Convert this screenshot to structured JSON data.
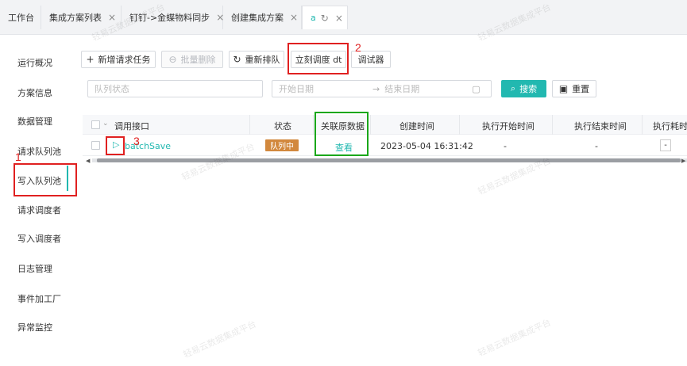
{
  "tabs": [
    {
      "label": "工作台",
      "closable": false
    },
    {
      "label": "集成方案列表",
      "closable": true
    },
    {
      "label": "钉钉->金蝶物料同步",
      "closable": true
    },
    {
      "label": "创建集成方案",
      "closable": true
    },
    {
      "label": "a",
      "closable": true,
      "active": true
    }
  ],
  "sidebar": {
    "items": [
      {
        "label": "运行概况"
      },
      {
        "label": "方案信息"
      },
      {
        "label": "数据管理"
      },
      {
        "label": "请求队列池"
      },
      {
        "label": "写入队列池",
        "active": true
      },
      {
        "label": "请求调度者"
      },
      {
        "label": "写入调度者"
      },
      {
        "label": "日志管理"
      },
      {
        "label": "事件加工厂"
      },
      {
        "label": "异常监控"
      }
    ]
  },
  "toolbar": {
    "add_label": "新增请求任务",
    "batch_delete_label": "批量删除",
    "requeue_label": "重新排队",
    "dispatch_label": "立刻调度 dt",
    "debugger_label": "调试器"
  },
  "filters": {
    "status_placeholder": "队列状态",
    "start_date_placeholder": "开始日期",
    "end_date_placeholder": "结束日期",
    "search_label": "搜索",
    "reset_label": "重置"
  },
  "table": {
    "columns": [
      "调用接口",
      "状态",
      "关联原数据",
      "创建时间",
      "执行开始时间",
      "执行结束时间",
      "执行耗时"
    ],
    "rows": [
      {
        "api": "batchSave",
        "status": "队列中",
        "related": "查看",
        "created": "2023-05-04 16:31:42",
        "start": "-",
        "end": "-",
        "duration": "-"
      }
    ]
  },
  "annotations": [
    {
      "number": "1",
      "color": "#e02020"
    },
    {
      "number": "2",
      "color": "#e02020"
    },
    {
      "number": "3",
      "color": "#e02020"
    },
    {
      "color": "#1aa71a"
    }
  ],
  "watermark": "轻易云数据集成平台",
  "colors": {
    "accent": "#22b8b0",
    "badge": "#d2883d",
    "annotation_red": "#e02020",
    "annotation_green": "#1aa71a"
  },
  "icons": {
    "close": "close-icon",
    "reload": "reload-icon",
    "plus": "plus-icon",
    "search": "search-icon",
    "reset": "reset-icon",
    "calendar": "calendar-icon",
    "play": "play-icon"
  }
}
